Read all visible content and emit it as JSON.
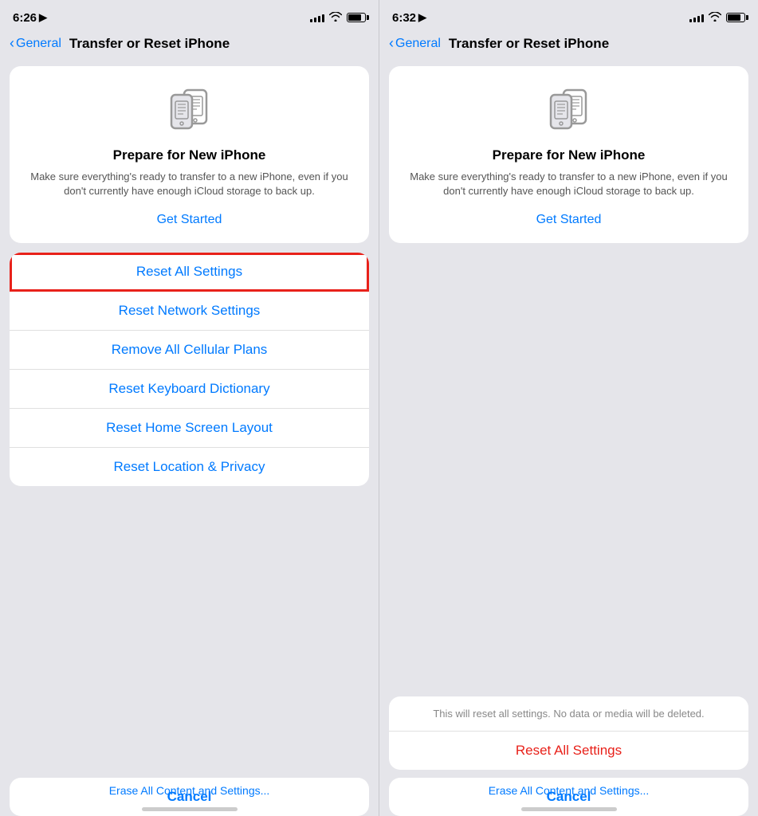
{
  "left_panel": {
    "status": {
      "time": "6:26",
      "location_icon": "◀"
    },
    "nav": {
      "back_label": "General",
      "title": "Transfer or Reset iPhone"
    },
    "prepare_card": {
      "title": "Prepare for New iPhone",
      "description": "Make sure everything's ready to transfer to a new iPhone, even if you don't currently have enough iCloud storage to back up.",
      "get_started": "Get Started"
    },
    "reset_items": [
      {
        "label": "Reset All Settings",
        "highlighted": true
      },
      {
        "label": "Reset Network Settings",
        "highlighted": false
      },
      {
        "label": "Remove All Cellular Plans",
        "highlighted": false
      },
      {
        "label": "Reset Keyboard Dictionary",
        "highlighted": false
      },
      {
        "label": "Reset Home Screen Layout",
        "highlighted": false
      },
      {
        "label": "Reset Location & Privacy",
        "highlighted": false
      }
    ],
    "cancel_label": "Cancel",
    "erase_hint": "Erase All Content and Settings..."
  },
  "right_panel": {
    "status": {
      "time": "6:32",
      "location_icon": "◀"
    },
    "nav": {
      "back_label": "General",
      "title": "Transfer or Reset iPhone"
    },
    "prepare_card": {
      "title": "Prepare for New iPhone",
      "description": "Make sure everything's ready to transfer to a new iPhone, even if you don't currently have enough iCloud storage to back up.",
      "get_started": "Get Started"
    },
    "dialog": {
      "message": "This will reset all settings. No data or media will be deleted.",
      "action_label": "Reset All Settings"
    },
    "cancel_label": "Cancel",
    "erase_hint": "Erase All Content and Settings..."
  }
}
